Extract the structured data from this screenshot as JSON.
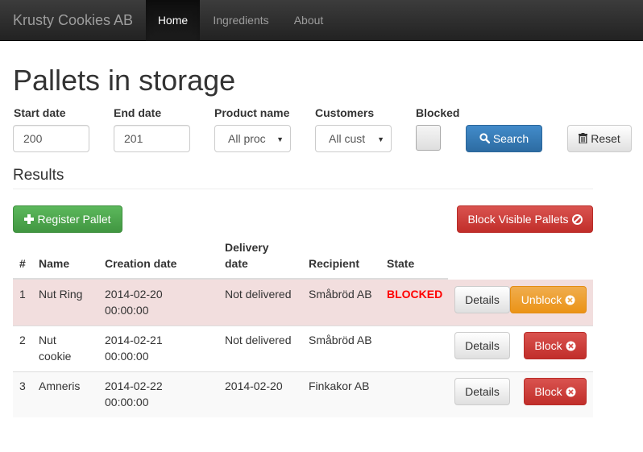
{
  "navbar": {
    "brand": "Krusty Cookies AB",
    "items": [
      "Home",
      "Ingredients",
      "About"
    ]
  },
  "page_title": "Pallets in storage",
  "filters": {
    "start_date": {
      "label": "Start date",
      "value": "200"
    },
    "end_date": {
      "label": "End date",
      "value": "201"
    },
    "product_name": {
      "label": "Product name",
      "value": "All proc"
    },
    "customers": {
      "label": "Customers",
      "value": "All cust"
    },
    "blocked": {
      "label": "Blocked",
      "checked": false
    },
    "search_label": "Search",
    "reset_label": "Reset"
  },
  "results_title": "Results",
  "register_label": "Register Pallet",
  "block_visible_label": "Block Visible Pallets",
  "table": {
    "headers": [
      "#",
      "Name",
      "Creation date",
      "Delivery date",
      "Recipient",
      "State"
    ],
    "header_delivery_line1": "Delivery",
    "header_delivery_line2": "date",
    "rows": [
      {
        "num": "1",
        "name_line1": "Nut Ring",
        "name_line2": "",
        "created_line1": "2014-02-20",
        "created_line2": "00:00:00",
        "delivery": "Not delivered",
        "recipient": "Småbröd AB",
        "state": "BLOCKED",
        "details": "Details",
        "action": "Unblock"
      },
      {
        "num": "2",
        "name_line1": "Nut",
        "name_line2": "cookie",
        "created_line1": "2014-02-21",
        "created_line2": "00:00:00",
        "delivery": "Not delivered",
        "recipient": "Småbröd AB",
        "state": "",
        "details": "Details",
        "action": "Block"
      },
      {
        "num": "3",
        "name_line1": "Amneris",
        "name_line2": "",
        "created_line1": "2014-02-22",
        "created_line2": "00:00:00",
        "delivery": "2014-02-20",
        "recipient": "Finkakor AB",
        "state": "",
        "details": "Details",
        "action": "Block"
      }
    ]
  },
  "colors": {
    "navbar": "#222222",
    "primary": "#428bca",
    "success": "#5cb85c",
    "danger": "#d9534f",
    "warning": "#f0ad4e",
    "blocked_text": "#ff0000",
    "blocked_row": "#f2dede"
  },
  "icons": {
    "search": "search-icon",
    "reset": "trash-icon",
    "register": "plus-icon",
    "block": "remove-circle-icon"
  }
}
